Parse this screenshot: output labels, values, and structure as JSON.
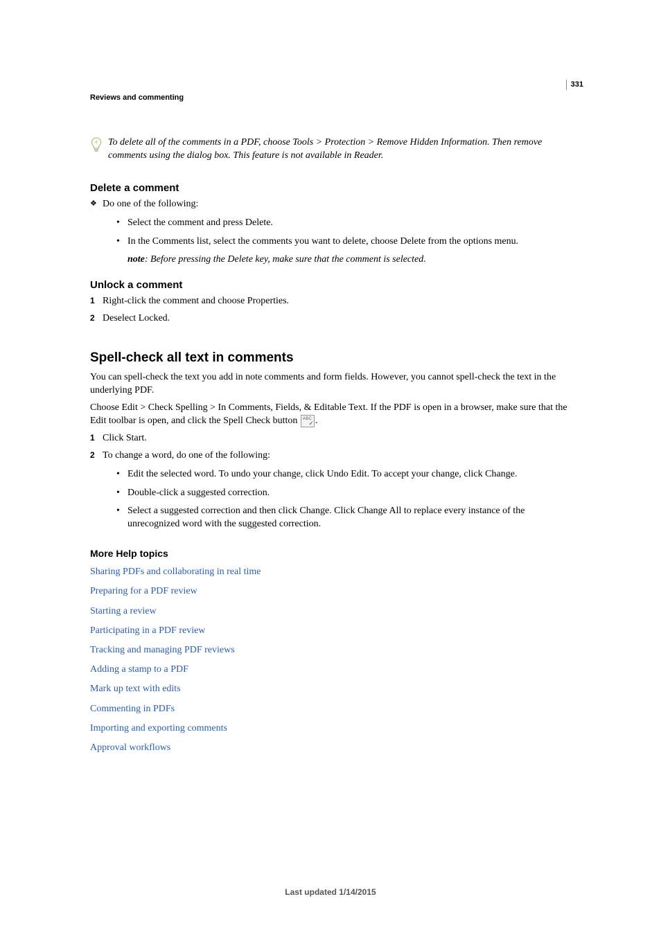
{
  "page_number": "331",
  "chapter_header": "Reviews and commenting",
  "tip_text": "To delete all of the comments in a PDF, choose Tools > Protection > Remove Hidden Information. Then remove comments using the dialog box. This feature is not available in Reader.",
  "sec1": {
    "title": "Delete a comment",
    "lead": "Do one of the following:",
    "b1": "Select the comment and press Delete.",
    "b2": "In the Comments list, select the comments you want to delete, choose Delete from the options menu.",
    "note_label": "note",
    "note_rest": ": Before pressing the Delete key, make sure that the comment is selected."
  },
  "sec2": {
    "title": "Unlock a comment",
    "s1": "Right-click the comment and choose Properties.",
    "s2": "Deselect Locked."
  },
  "sec3": {
    "title": "Spell-check all text in comments",
    "p1": "You can spell-check the text you add in note comments and form fields. However, you cannot spell-check the text in the underlying PDF.",
    "p2a": "Choose Edit > Check Spelling > In Comments, Fields, & Editable Text. If the PDF is open in a browser, make sure that the Edit toolbar is open, and click the Spell Check button ",
    "p2b": ".",
    "s1": "Click Start.",
    "s2": "To change a word, do one of the following:",
    "b1": "Edit the selected word. To undo your change, click Undo Edit. To accept your change, click Change.",
    "b2": "Double-click a suggested correction.",
    "b3": "Select a suggested correction and then click Change. Click Change All to replace every instance of the unrecognized word with the suggested correction."
  },
  "more_help": {
    "title": "More Help topics",
    "links": [
      "Sharing PDFs and collaborating in real time",
      "Preparing for a PDF review",
      "Starting a review",
      "Participating in a PDF review",
      "Tracking and managing PDF reviews",
      "Adding a stamp to a PDF",
      "Mark up text with edits",
      "Commenting in PDFs",
      "Importing and exporting comments",
      "Approval workflows"
    ]
  },
  "footer": "Last updated 1/14/2015"
}
